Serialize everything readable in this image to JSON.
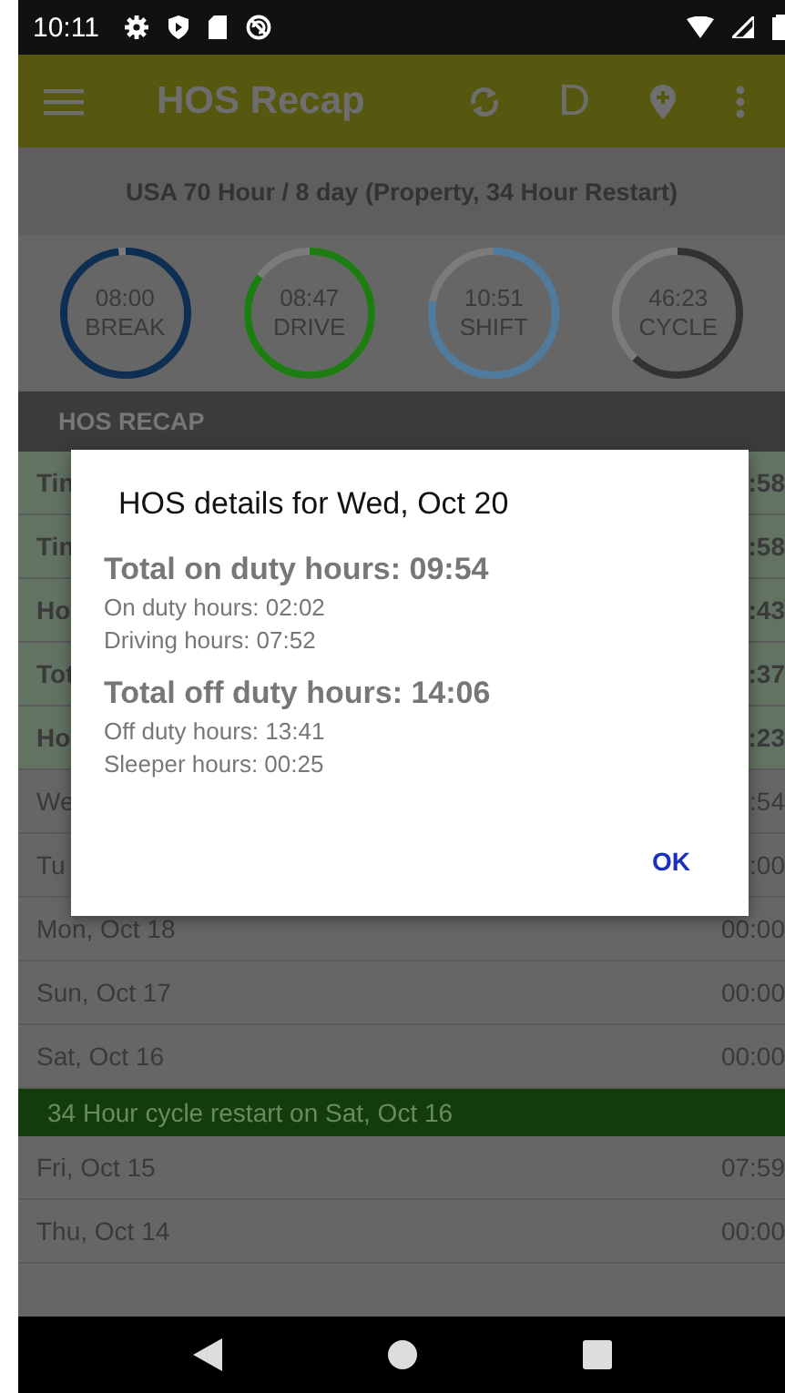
{
  "status_bar": {
    "time": "10:11"
  },
  "app_bar": {
    "title": "HOS Recap",
    "action_letter": "D"
  },
  "ruleset": "USA 70 Hour / 8 day (Property, 34 Hour Restart)",
  "gauges": [
    {
      "time": "08:00",
      "label": "BREAK",
      "level": 0.98,
      "color": "#0e2e52"
    },
    {
      "time": "08:47",
      "label": "DRIVE",
      "level": 0.85,
      "color": "#1e7d12"
    },
    {
      "time": "10:51",
      "label": "SHIFT",
      "level": 0.78,
      "color": "#4f7b9e"
    },
    {
      "time": "46:23",
      "label": "CYCLE",
      "level": 0.62,
      "color": "#323232"
    }
  ],
  "section_header": "HOS RECAP",
  "rows": [
    {
      "kind": "summary",
      "label": "Tin",
      "value": ":58"
    },
    {
      "kind": "summary",
      "label": "Tin",
      "value": ":58"
    },
    {
      "kind": "summary",
      "label": "Ho",
      "value": ":43"
    },
    {
      "kind": "summary",
      "label": "Tot",
      "value": ":37"
    },
    {
      "kind": "summary",
      "label": "Ho",
      "value": ":23"
    },
    {
      "kind": "day",
      "label": "We",
      "value": ":54"
    },
    {
      "kind": "day",
      "label": "Tu",
      "value": ":00"
    },
    {
      "kind": "day",
      "label": "Mon, Oct 18",
      "value": "00:00"
    },
    {
      "kind": "day",
      "label": "Sun, Oct 17",
      "value": "00:00"
    },
    {
      "kind": "day",
      "label": "Sat, Oct 16",
      "value": "00:00"
    },
    {
      "kind": "restart",
      "label": "34 Hour cycle restart on Sat, Oct 16"
    },
    {
      "kind": "day",
      "label": "Fri, Oct 15",
      "value": "07:59"
    },
    {
      "kind": "day",
      "label": "Thu, Oct 14",
      "value": "00:00"
    }
  ],
  "dialog": {
    "title": "HOS details for Wed, Oct 20",
    "groups": [
      {
        "total": "Total on duty hours: 09:54",
        "details": [
          "On duty hours: 02:02",
          "Driving hours: 07:52"
        ]
      },
      {
        "total": "Total off duty hours: 14:06",
        "details": [
          "Off duty hours: 13:41",
          "Sleeper hours: 00:25"
        ]
      }
    ],
    "button": "OK"
  }
}
